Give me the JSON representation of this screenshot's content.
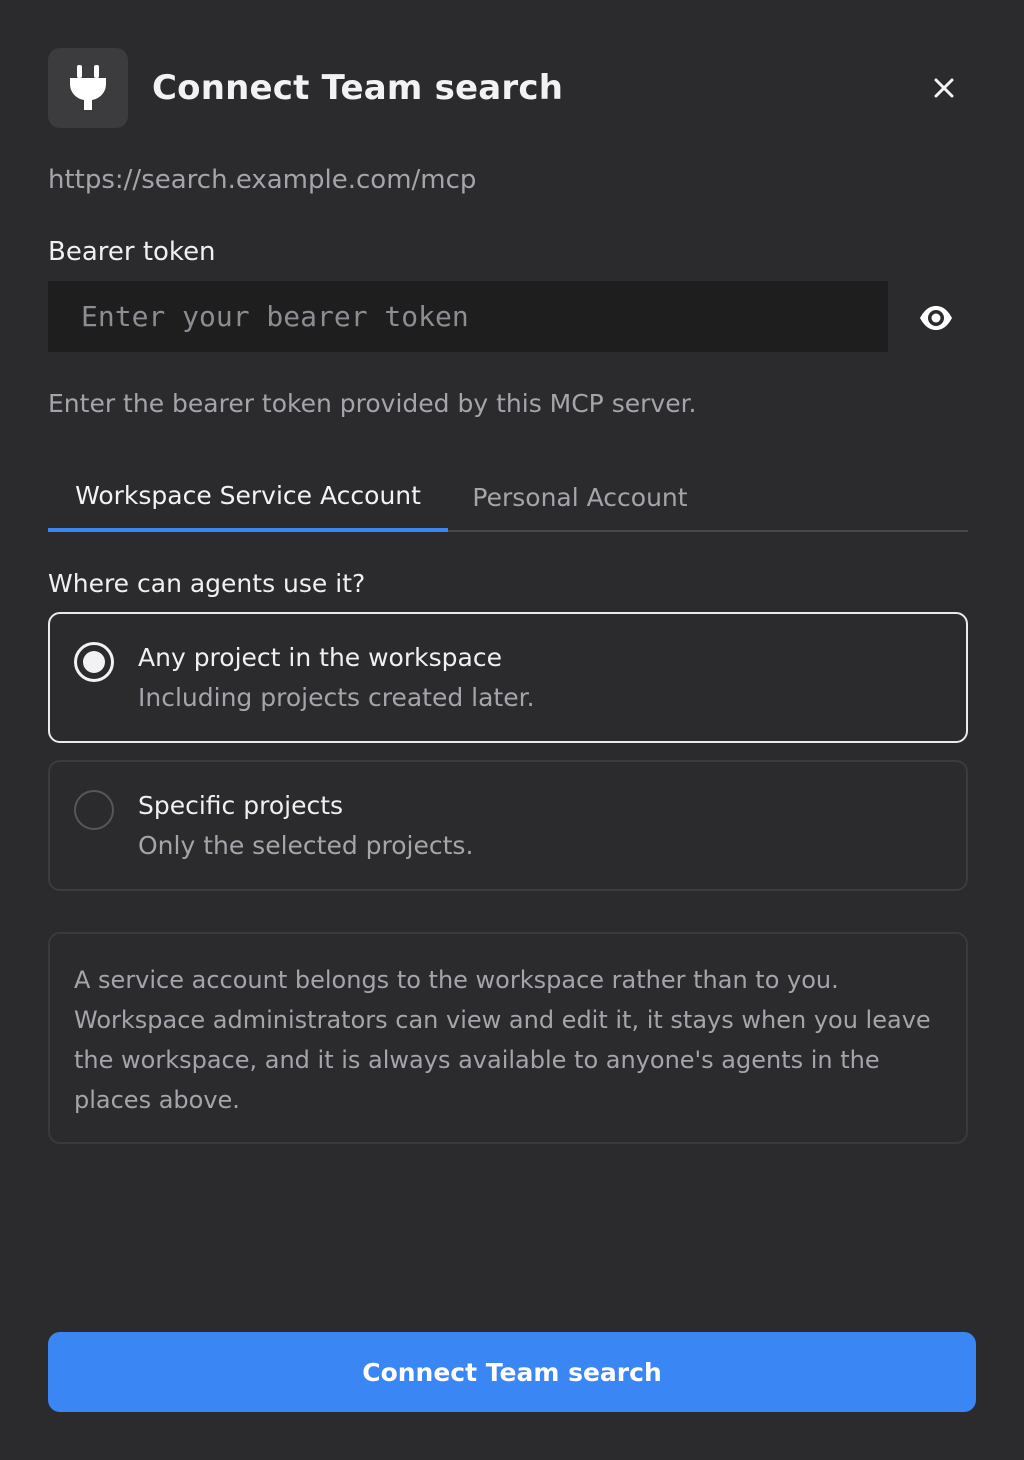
{
  "dialog": {
    "title": "Connect Team search",
    "icon": "plug-icon",
    "close_icon": "close-icon",
    "server_url": "https://search.example.com/mcp"
  },
  "token": {
    "label": "Bearer token",
    "value": "",
    "placeholder": "Enter your bearer token",
    "visibility_icon": "eye-icon",
    "helper": "Enter the bearer token provided by this MCP server."
  },
  "tabs": [
    {
      "label": "Workspace Service Account",
      "active": true
    },
    {
      "label": "Personal Account",
      "active": false
    }
  ],
  "scope": {
    "question": "Where can agents use it?",
    "options": [
      {
        "title": "Any project in the workspace",
        "subtitle": "Including projects created later.",
        "selected": true
      },
      {
        "title": "Specific projects",
        "subtitle": "Only the selected projects.",
        "selected": false
      }
    ]
  },
  "info": "A service account belongs to the workspace rather than to you. Workspace administrators can view and edit it, it stays when you leave the workspace, and it is always available to anyone's agents in the places above.",
  "actions": {
    "connect_label": "Connect Team search"
  },
  "colors": {
    "background": "#2b2b2d",
    "accent": "#3a86f5",
    "input_background": "#1e1e1f"
  }
}
